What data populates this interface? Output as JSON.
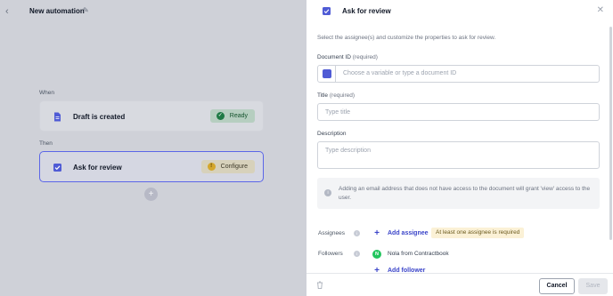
{
  "canvas": {
    "title": "New automation",
    "when_label": "When",
    "then_label": "Then",
    "trigger": {
      "title": "Draft is created",
      "status": "Ready",
      "icon": "document-icon",
      "status_color": "#1f7a45"
    },
    "action": {
      "title": "Ask for review",
      "status": "Configure",
      "icon": "checkbox-icon",
      "status_color": "#d4a72c"
    }
  },
  "panel": {
    "title": "Ask for review",
    "intro": "Select the assignee(s) and customize the properties to ask for review.",
    "document_id": {
      "label": "Document ID",
      "required": "(required)",
      "placeholder": "Choose a variable or type a document ID"
    },
    "title_field": {
      "label": "Title",
      "required": "(required)",
      "placeholder": "Type title"
    },
    "description": {
      "label": "Description",
      "placeholder": "Type description"
    },
    "notice": "Adding an email address that does not have access to the document will grant 'view' access to the user.",
    "assignees": {
      "label": "Assignees",
      "add_label": "Add assignee",
      "warning": "At least one assignee is required"
    },
    "followers": {
      "label": "Followers",
      "items": [
        {
          "initial": "N",
          "name": "Nola from Contractbook"
        }
      ],
      "add_label": "Add follower"
    },
    "footer": {
      "cancel": "Cancel",
      "save": "Save"
    }
  },
  "colors": {
    "accent": "#4f5bd5",
    "selected_border": "#5b66e8",
    "link": "#3b45c9"
  }
}
